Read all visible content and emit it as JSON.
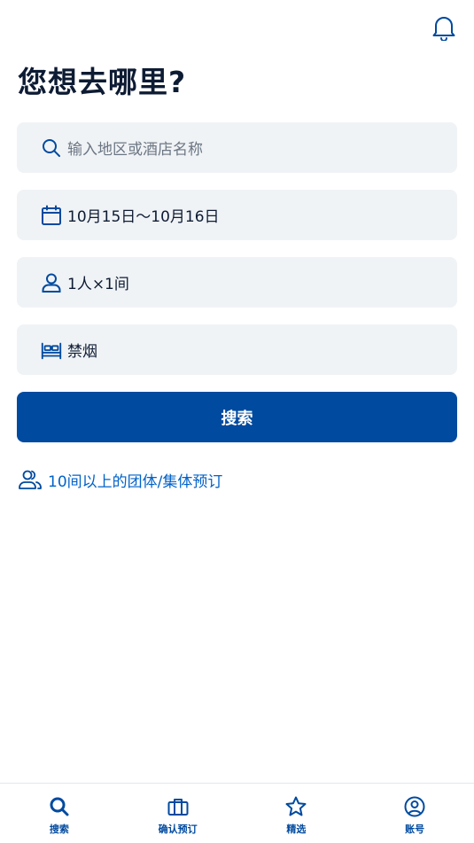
{
  "header": {
    "notification_icon": "bell-icon"
  },
  "page": {
    "title": "您想去哪里?"
  },
  "form": {
    "destination": {
      "icon": "search-icon",
      "placeholder": "输入地区或酒店名称",
      "value": ""
    },
    "dates": {
      "icon": "calendar-icon",
      "value": "10月15日〜10月16日"
    },
    "guests": {
      "icon": "person-icon",
      "value": "1人×1间"
    },
    "room_type": {
      "icon": "bed-icon",
      "value": "禁烟"
    },
    "search_button_label": "搜索"
  },
  "group_booking": {
    "icon": "group-icon",
    "label": "10间以上的团体/集体预订"
  },
  "tabbar": {
    "tabs": [
      {
        "label": "搜索",
        "icon": "search-icon"
      },
      {
        "label": "确认预订",
        "icon": "briefcase-icon"
      },
      {
        "label": "精选",
        "icon": "star-icon"
      },
      {
        "label": "账号",
        "icon": "account-icon"
      }
    ]
  },
  "colors": {
    "primary": "#004a9f",
    "link": "#0062c8",
    "field_bg": "#f0f3f6",
    "text": "#0d1b33"
  }
}
